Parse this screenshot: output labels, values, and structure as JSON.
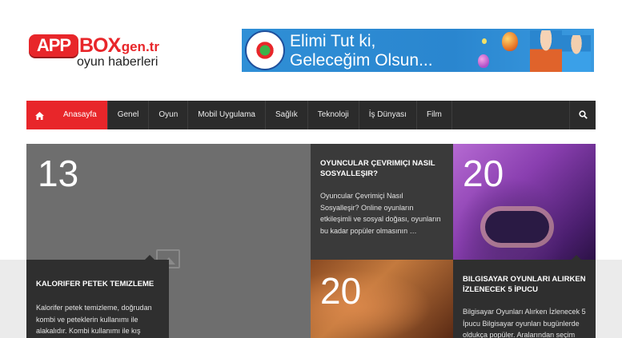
{
  "logo": {
    "app": "APP",
    "box": "BOX",
    "tld": ".gen.tr",
    "subtitle": "oyun haberleri"
  },
  "banner": {
    "line1": "Elimi Tut ki,",
    "line2": "Geleceğim Olsun..."
  },
  "nav": {
    "items": [
      "Anasayfa",
      "Genel",
      "Oyun",
      "Mobil Uygulama",
      "Sağlık",
      "Teknoloji",
      "İş Dünyası",
      "Film"
    ],
    "active_index": 0
  },
  "posts": [
    {
      "number": "13",
      "title": "KALORIFER PETEK TEMIZLEME",
      "excerpt": "Kalorifer petek temizleme, doğrudan kombi ve peteklerin kullanımı ile alakalıdır. Kombi kullanımı ile kış"
    },
    {
      "title": "OYUNCULAR ÇEVRIMIÇI NASIL SOSYALLEŞIR?",
      "excerpt": "Oyuncular Çevrimiçi Nasıl Sosyalleşir?  Online oyunların etkileşimli ve sosyal doğası, oyunların bu kadar popüler olmasının …"
    },
    {
      "number": "20"
    },
    {
      "number": "20"
    },
    {
      "title": "BILGISAYAR OYUNLARI ALIRKEN İZLENECEK 5 İPUCU",
      "excerpt": "Bilgisayar Oyunları Alırken İzlenecek 5 İpucu Bilgisayar oyunları bugünlerde oldukça popüler. Aralarından seçim"
    }
  ],
  "colors": {
    "accent": "#e8262a",
    "nav_bg": "#2b2b2b",
    "caption_bg": "#2f2f2f"
  },
  "icons": {
    "home": "home-icon",
    "search": "search-icon"
  }
}
